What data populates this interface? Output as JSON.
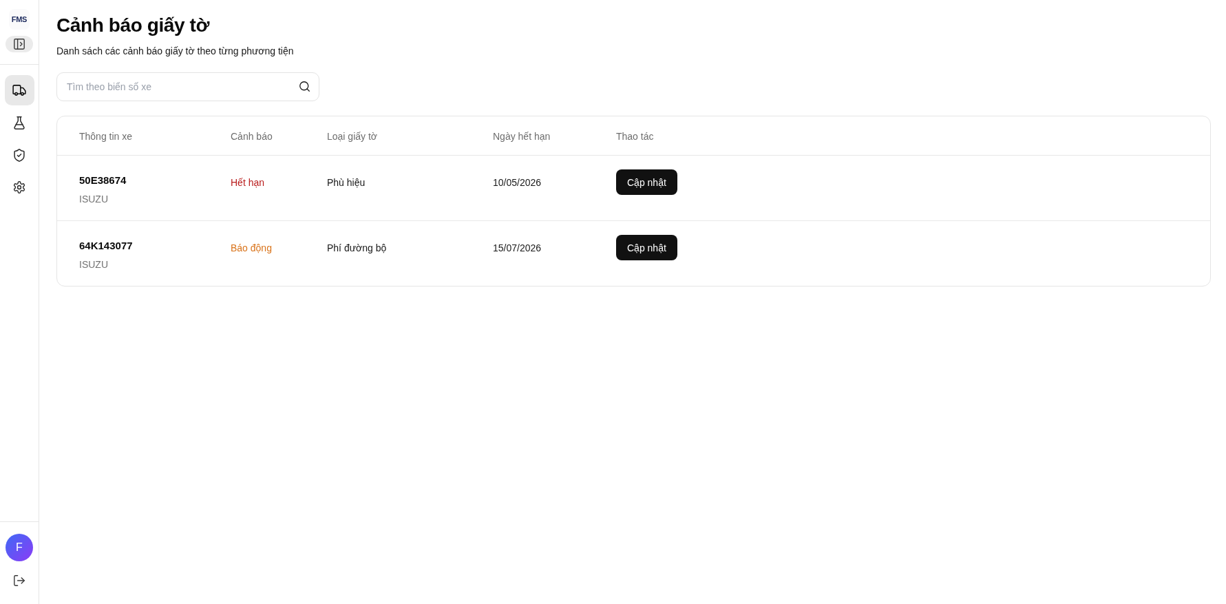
{
  "sidebar": {
    "logo": "FMS",
    "nav_items": [
      {
        "kind": "truck",
        "selected": true
      },
      {
        "kind": "flask",
        "selected": false
      },
      {
        "kind": "shield",
        "selected": false
      },
      {
        "kind": "gear",
        "selected": false
      }
    ],
    "user": {
      "initial": "F"
    }
  },
  "header": {
    "title": "Cảnh báo giấy tờ",
    "subtitle": "Danh sách các cảnh báo giấy tờ theo từng phương tiện"
  },
  "search": {
    "placeholder": "Tìm theo biển số xe"
  },
  "table": {
    "columns": [
      "Thông tin xe",
      "Cảnh báo",
      "Loại giấy tờ",
      "Ngày hết hạn",
      "Thao tác"
    ],
    "rows": [
      {
        "plate": "50E38674",
        "model": "ISUZU",
        "alert": {
          "text": "Hết hạn",
          "color": "#b91c1c"
        },
        "document": "Phù hiệu",
        "expiry": "10/05/2026",
        "action": "Cập nhật"
      },
      {
        "plate": "64K143077",
        "model": "ISUZU",
        "alert": {
          "text": "Báo động",
          "color": "#d9731a"
        },
        "document": "Phí đường bộ",
        "expiry": "15/07/2026",
        "action": "Cập nhật"
      }
    ]
  }
}
